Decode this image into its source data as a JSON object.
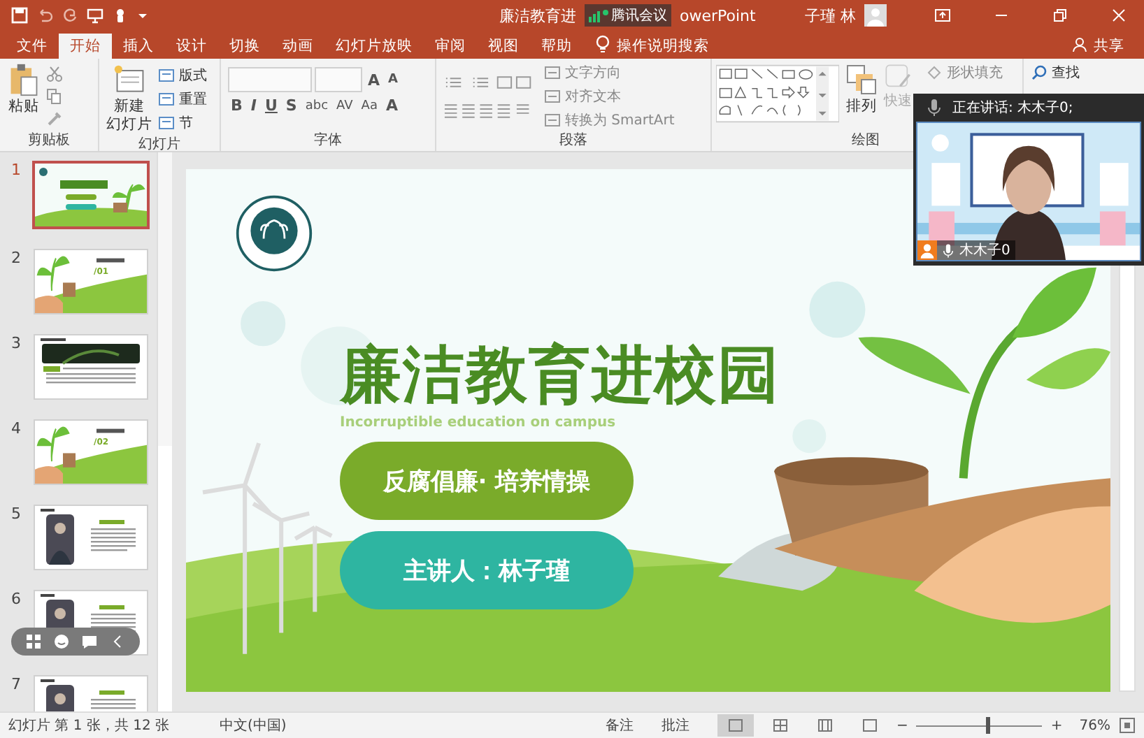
{
  "window": {
    "title_start": "廉洁教育进",
    "title_end": "owerPoint",
    "user": "子瑾 林"
  },
  "meeting_badge": {
    "label": "腾讯会议"
  },
  "menu_tabs": [
    {
      "label": "文件",
      "selected": false
    },
    {
      "label": "开始",
      "selected": true
    },
    {
      "label": "插入",
      "selected": false
    },
    {
      "label": "设计",
      "selected": false
    },
    {
      "label": "切换",
      "selected": false
    },
    {
      "label": "动画",
      "selected": false
    },
    {
      "label": "幻灯片放映",
      "selected": false
    },
    {
      "label": "审阅",
      "selected": false
    },
    {
      "label": "视图",
      "selected": false
    },
    {
      "label": "帮助",
      "selected": false
    }
  ],
  "tell_me": {
    "placeholder": "操作说明搜索"
  },
  "share": "共享",
  "ribbon": [
    {
      "kind": "clipboard",
      "label": "剪贴板",
      "paste": "粘贴"
    },
    {
      "kind": "slides",
      "label": "幻灯片",
      "new_slide": [
        "新建",
        "幻灯片"
      ],
      "commands": [
        "版式",
        "重置",
        "节"
      ]
    },
    {
      "kind": "font",
      "label": "字体",
      "size_buttons": [
        "A",
        "A"
      ],
      "format_buttons": [
        "B",
        "I",
        "U",
        "S",
        "abc",
        "AV",
        "Aa",
        "A"
      ]
    },
    {
      "kind": "paragraph",
      "label": "段落",
      "commands": [
        "文字方向",
        "对齐文本",
        "转换为 SmartArt"
      ]
    },
    {
      "kind": "drawing",
      "label": "绘图",
      "arrange": "排列",
      "quick_styles": "快速",
      "shape_fill": "形状填充"
    },
    {
      "kind": "editing",
      "find": "查找"
    }
  ],
  "thumbnails": [
    {
      "number": "1",
      "selected": true,
      "kind": "cover"
    },
    {
      "number": "2",
      "selected": false,
      "kind": "section",
      "tag": "/01"
    },
    {
      "number": "3",
      "selected": false,
      "kind": "banner"
    },
    {
      "number": "4",
      "selected": false,
      "kind": "section",
      "tag": "/02"
    },
    {
      "number": "5",
      "selected": false,
      "kind": "profile"
    },
    {
      "number": "6",
      "selected": false,
      "kind": "profile"
    },
    {
      "number": "7",
      "selected": false,
      "kind": "profile"
    }
  ],
  "slide": {
    "title": "廉洁教育进校园",
    "subtitle": "Incorruptible education on campus",
    "pills": [
      {
        "text": "反腐倡廉· 培养情操",
        "color": "#7aab2a"
      },
      {
        "text": "主讲人：林子瑾",
        "color": "#2eb5a1"
      }
    ]
  },
  "video": {
    "speaking_label": "正在讲话: 木木子0;",
    "participant": "木木子0"
  },
  "status_bar": {
    "slide_info": "幻灯片 第 1 张，共 12 张",
    "language": "中文(中国)",
    "notes": "备注",
    "comments": "批注",
    "views": [
      {
        "selected": true
      },
      {
        "selected": false
      },
      {
        "selected": false
      },
      {
        "selected": false
      }
    ],
    "zoom_out": "−",
    "zoom_in": "+",
    "zoom": "76%",
    "level": 0.55
  }
}
